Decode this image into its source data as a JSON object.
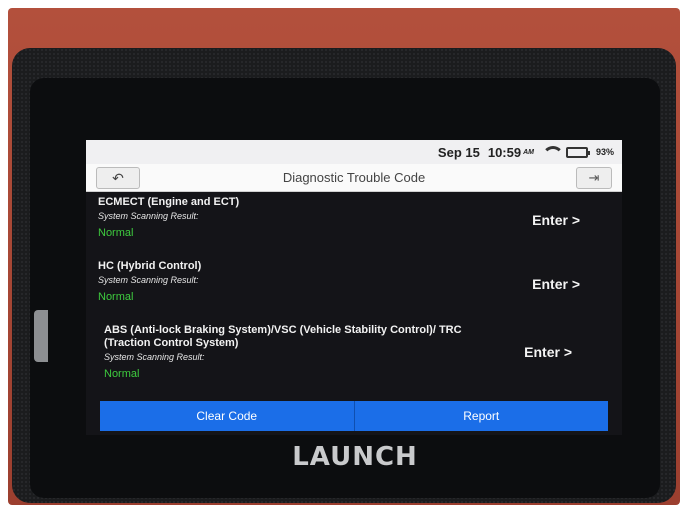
{
  "status_bar": {
    "date": "Sep 15",
    "time": "10:59",
    "ampm": "AM",
    "battery_percent": "93%",
    "battery_level": 0.93,
    "wifi_icon": "wifi-icon",
    "battery_icon": "battery-icon"
  },
  "header": {
    "title": "Diagnostic Trouble Code",
    "back_icon": "back-arrow-icon",
    "exit_icon": "exit-icon"
  },
  "systems": [
    {
      "name": "ECMECT (Engine and ECT)",
      "label": "System Scanning Result:",
      "result": "Normal",
      "enter": "Enter >"
    },
    {
      "name": "HC (Hybrid Control)",
      "label": "System Scanning Result:",
      "result": "Normal",
      "enter": "Enter >"
    },
    {
      "name": "ABS (Anti-lock Braking System)/VSC (Vehicle Stability Control)/ TRC (Traction Control System)",
      "label": "System Scanning Result:",
      "result": "Normal",
      "enter": "Enter >"
    }
  ],
  "actions": {
    "clear_code": "Clear Code",
    "report": "Report"
  },
  "device": {
    "brand": "LAUNCH"
  },
  "colors": {
    "accent": "#1b6ee8",
    "normal_status": "#3ecb3e",
    "device_body": "#b3503c"
  }
}
